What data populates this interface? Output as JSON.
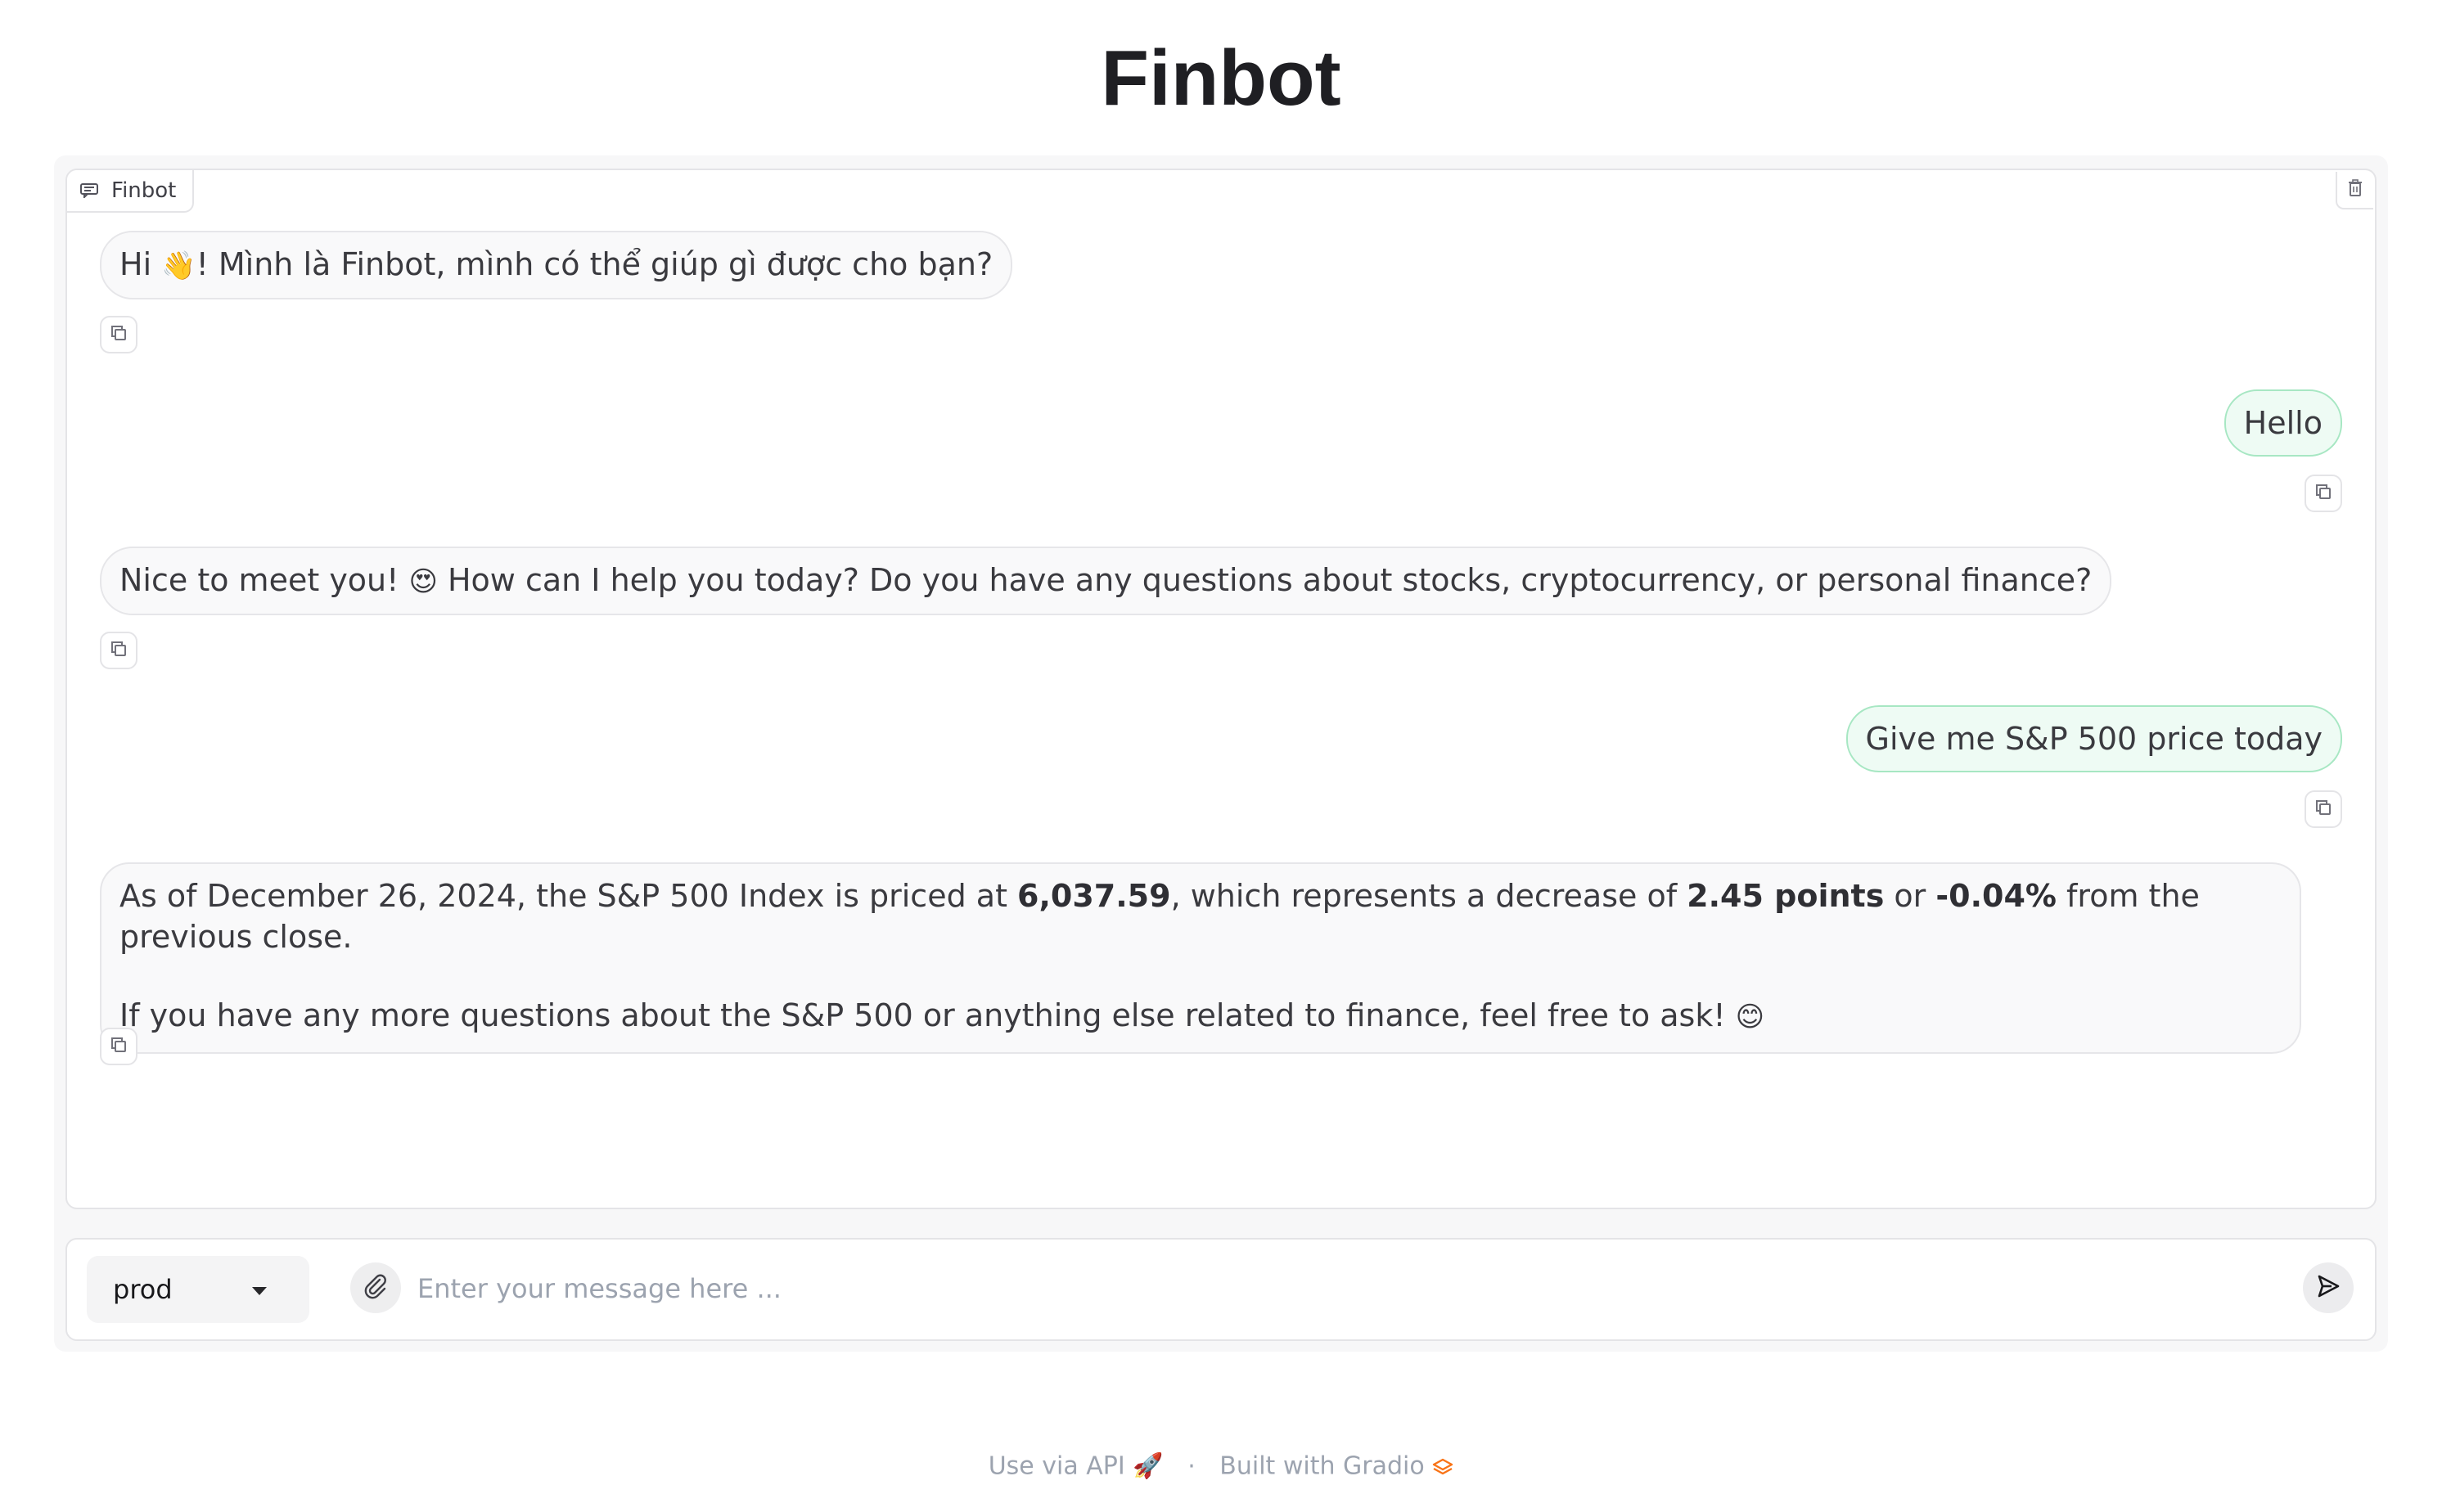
{
  "title": "Finbot",
  "chatbot": {
    "label": "Finbot",
    "label_icon": "chat-icon",
    "clear_icon": "trash-icon"
  },
  "messages": [
    {
      "role": "bot",
      "text_before": "Hi ",
      "emoji": "👋",
      "text_after": "! Mình là Finbot, mình có thể giúp gì được cho bạn?"
    },
    {
      "role": "user",
      "text": "Hello"
    },
    {
      "role": "bot",
      "text_before": "Nice to meet you! ",
      "emoji": "😍",
      "text_after": " How can I help you today? Do you have any questions about stocks, cryptocurrency, or personal finance?"
    },
    {
      "role": "user",
      "text": "Give me S&P 500 price today"
    },
    {
      "role": "bot",
      "p1_a": "As of December 26, 2024, the S&P 500 Index is priced at ",
      "p1_b": "6,037.59",
      "p1_c": ", which represents a decrease of ",
      "p1_d": "2.45 points",
      "p1_e": " or ",
      "p1_f": "-0.04%",
      "p1_g": " from the previous close.",
      "p2_a": "If you have any more questions about the S&P 500 or anything else related to finance, feel free to ask! ",
      "p2_emoji": "😊"
    }
  ],
  "copy_icon": "copy-icon",
  "input": {
    "model_value": "prod",
    "placeholder": "Enter your message here ...",
    "value": "",
    "attach_icon": "paperclip-icon",
    "send_icon": "send-icon"
  },
  "footer": {
    "api_label": "Use via API",
    "api_emoji": "🚀",
    "separator": "·",
    "built_label": "Built with Gradio",
    "built_icon": "gradio-logo-icon"
  },
  "colors": {
    "user_bubble_bg": "#eefbf4",
    "user_bubble_border": "#a7e7c3",
    "bot_bubble_bg": "#f9f9fa",
    "gradio_orange": "#f97316"
  }
}
